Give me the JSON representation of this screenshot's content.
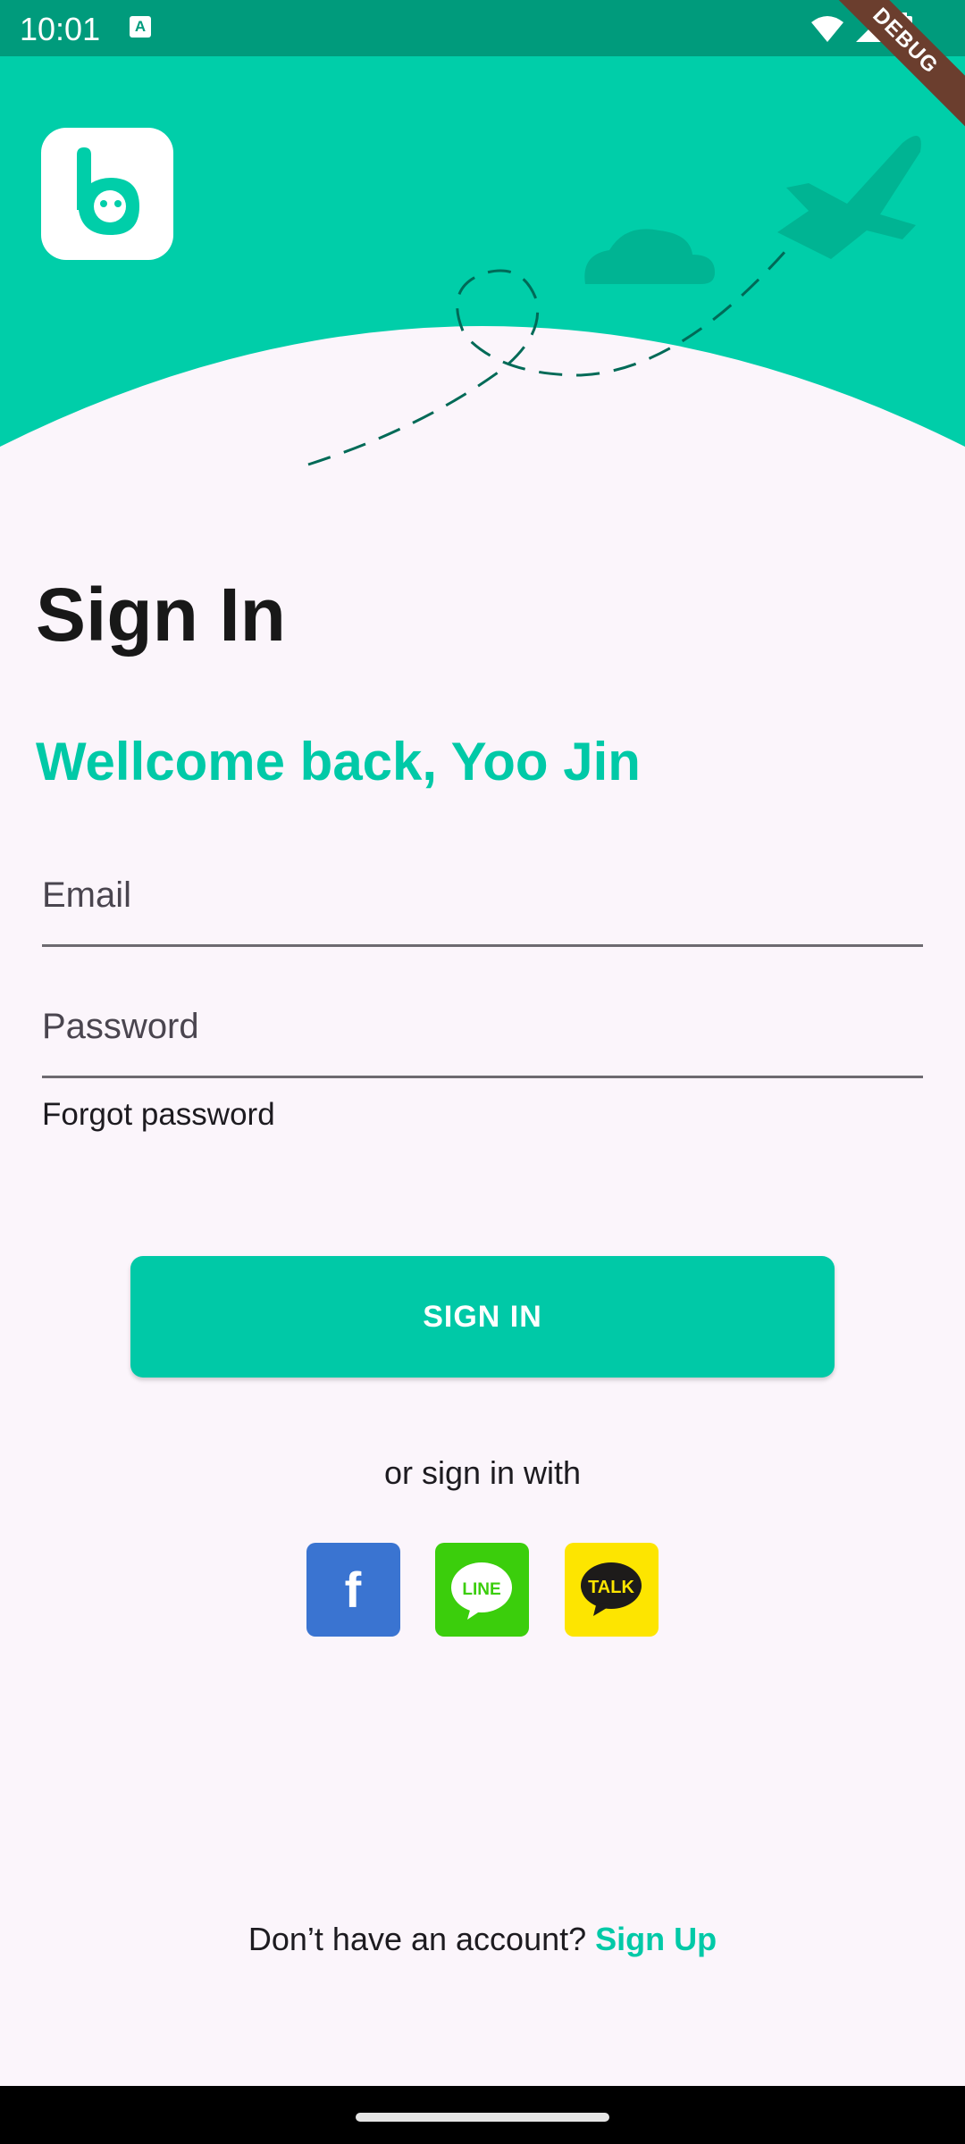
{
  "status_bar": {
    "time": "10:01",
    "a_icon_label": "A"
  },
  "debug_ribbon": "DEBUG",
  "page": {
    "title": "Sign In",
    "welcome": "Wellcome back, Yoo Jin"
  },
  "form": {
    "email_label": "Email",
    "password_label": "Password",
    "forgot_password": "Forgot password",
    "sign_in_button": "SIGN IN"
  },
  "social": {
    "prompt": "or sign in with",
    "providers": [
      {
        "name": "facebook",
        "icon": "facebook-icon",
        "color": "#3a74d1",
        "glyph": "f"
      },
      {
        "name": "line",
        "icon": "line-icon",
        "color": "#3bce0c",
        "glyph": "LINE"
      },
      {
        "name": "kakaotalk",
        "icon": "kakaotalk-icon",
        "color": "#fde500",
        "glyph": "TALK"
      }
    ]
  },
  "signup": {
    "prompt": "Don’t have an account?",
    "link": "Sign Up"
  },
  "colors": {
    "primary": "#00c9a7",
    "status_bar": "#009b7c",
    "background": "#fbf5fb"
  }
}
